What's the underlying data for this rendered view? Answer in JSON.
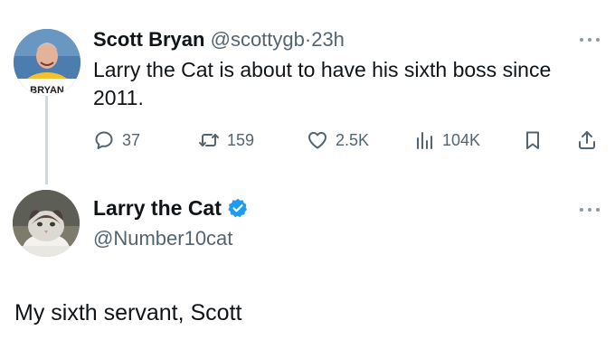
{
  "reply_tweet": {
    "author_name": "Scott Bryan",
    "author_handle": "@scottygb",
    "separator": "·",
    "time": "23h",
    "avatar_label": "BRYAN",
    "text": "Larry the Cat is about to have his sixth boss since 2011.",
    "actions": {
      "replies": "37",
      "retweets": "159",
      "likes": "2.5K",
      "views": "104K"
    },
    "icons": [
      "more-icon",
      "reply-icon",
      "retweet-icon",
      "like-icon",
      "views-icon",
      "bookmark-icon",
      "share-icon"
    ]
  },
  "main_tweet": {
    "author_name": "Larry the Cat",
    "author_handle": "@Number10cat",
    "verified": true,
    "text": "My sixth servant, Scott"
  },
  "colors": {
    "text_primary": "#0f1419",
    "text_secondary": "#536471",
    "thread_line": "#cfd9de",
    "verified_blue": "#1d9bf0"
  }
}
